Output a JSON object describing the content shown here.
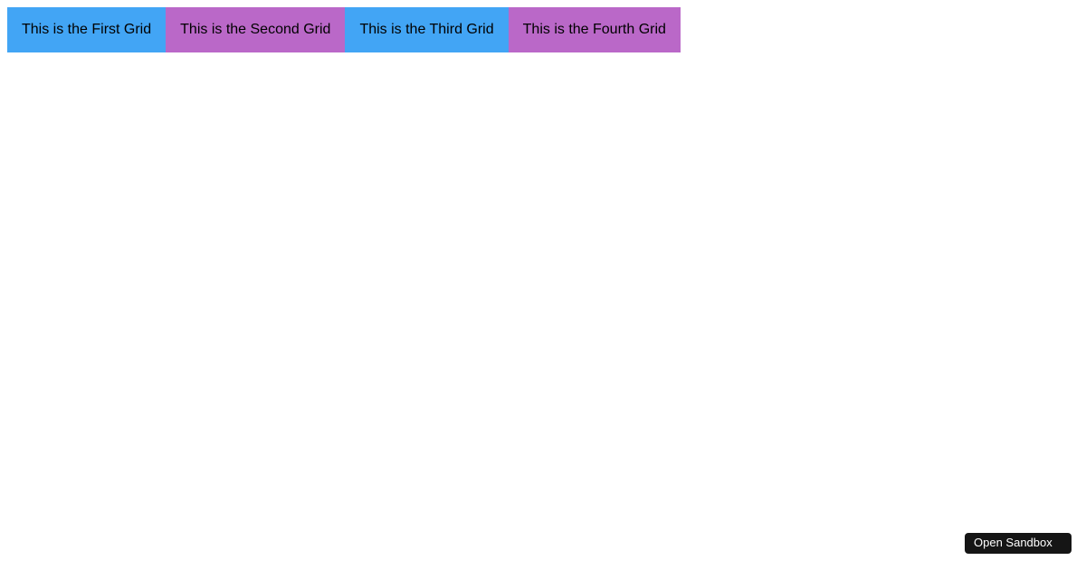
{
  "grids": {
    "item1": "This is the First Grid",
    "item2": "This is the Second Grid",
    "item3": "This is the Third Grid",
    "item4": "This is the Fourth Grid"
  },
  "sandbox": {
    "label": "Open Sandbox"
  },
  "colors": {
    "blue": "#42a5f5",
    "purple": "#ba68c8",
    "sandboxBg": "#151515"
  }
}
